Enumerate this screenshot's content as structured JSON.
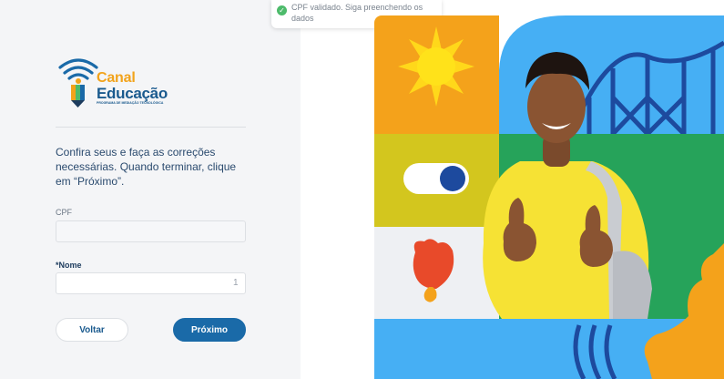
{
  "toast": {
    "message": "CPF validado. Siga preenchendo os dados",
    "icon": "check-circle-icon"
  },
  "logo": {
    "line1": "Canal",
    "line2": "Educação",
    "tagline": "PROGRAMA DE MEDIAÇÃO TECNOLÓGICA"
  },
  "form": {
    "instructions": "Confira seus e faça as correções necessárias. Quando terminar, clique em “Próximo”.",
    "cpf_label": "CPF",
    "cpf_value": "",
    "nome_label": "*Nome",
    "nome_value": "",
    "nome_counter": "1"
  },
  "buttons": {
    "back": "Voltar",
    "next": "Próximo"
  },
  "colors": {
    "primary": "#1a6aa8",
    "brand_orange": "#f2a31b",
    "brand_blue": "#1a5a8e",
    "success": "#4dbb6b"
  }
}
